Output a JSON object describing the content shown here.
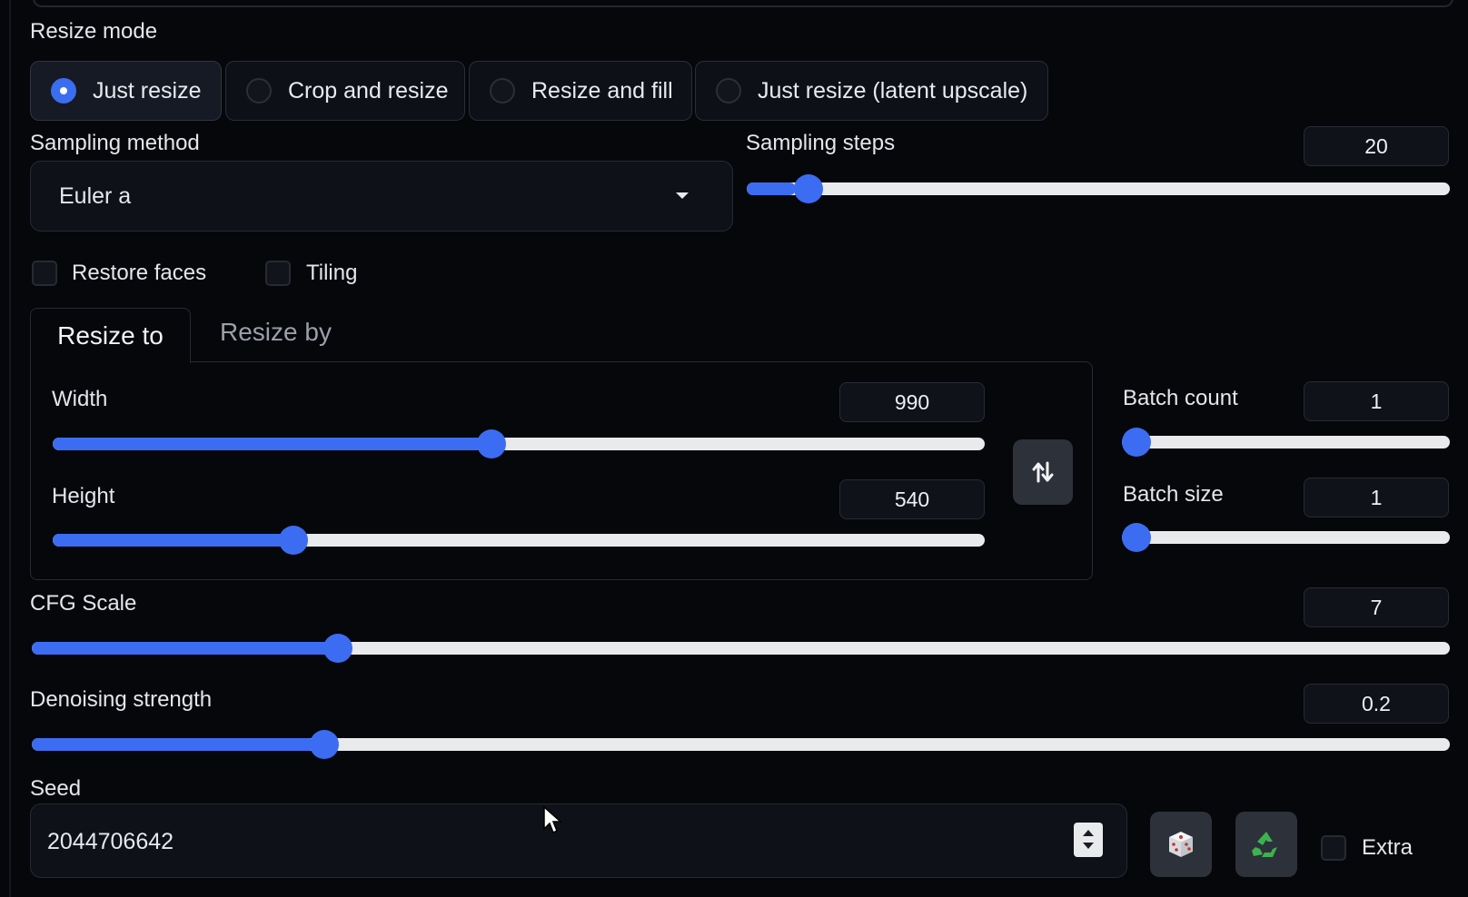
{
  "resize_mode": {
    "label": "Resize mode",
    "options": [
      "Just resize",
      "Crop and resize",
      "Resize and fill",
      "Just resize (latent upscale)"
    ],
    "selected": "Just resize"
  },
  "sampling_method": {
    "label": "Sampling method",
    "value": "Euler a"
  },
  "sampling_steps": {
    "label": "Sampling steps",
    "value": "20",
    "level": 0.07
  },
  "checkboxes": {
    "restore_faces": {
      "label": "Restore faces",
      "checked": false
    },
    "tiling": {
      "label": "Tiling",
      "checked": false
    }
  },
  "tabs": {
    "resize_to": "Resize to",
    "resize_by": "Resize by",
    "active": "Resize to"
  },
  "width": {
    "label": "Width",
    "value": "990",
    "level": 0.47
  },
  "height": {
    "label": "Height",
    "value": "540",
    "level": 0.25
  },
  "batch_count": {
    "label": "Batch count",
    "value": "1",
    "level": 0.0
  },
  "batch_size": {
    "label": "Batch size",
    "value": "1",
    "level": 0.0
  },
  "cfg_scale": {
    "label": "CFG Scale",
    "value": "7",
    "level": 0.21
  },
  "denoising_strength": {
    "label": "Denoising strength",
    "value": "0.2",
    "level": 0.2
  },
  "seed": {
    "label": "Seed",
    "value": "2044706642"
  },
  "extra": {
    "label": "Extra",
    "checked": false
  },
  "icons": {
    "swap": "swap-dimensions-icon",
    "dice": "dice-icon",
    "recycle": "recycle-icon",
    "dropdown": "chevron-down-icon"
  },
  "colors": {
    "accent": "#3c6cf1",
    "background": "#05070b",
    "track": "#e9eaec",
    "button": "#2c313a"
  }
}
